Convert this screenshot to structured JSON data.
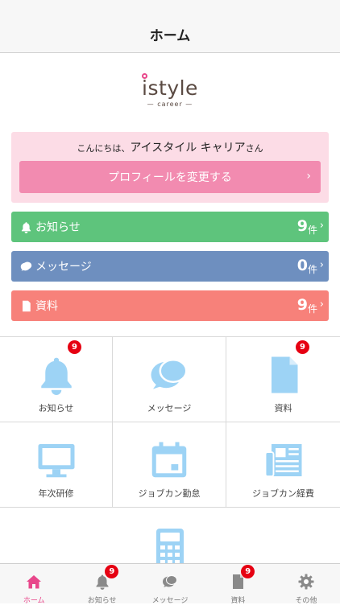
{
  "nav": {
    "title": "ホーム"
  },
  "logo": {
    "text": "istyle",
    "sub": "— career —"
  },
  "greeting": {
    "prefix": "こんにちは、",
    "name": "アイスタイル キャリア",
    "suffix": "さん"
  },
  "profile_button": {
    "label": "プロフィールを変更する",
    "chevron": "›"
  },
  "summary": [
    {
      "label": "お知らせ",
      "count": "9",
      "unit": "件",
      "color": "#5ec47c",
      "icon": "bell-icon"
    },
    {
      "label": "メッセージ",
      "count": "0",
      "unit": "件",
      "color": "#6e8fbf",
      "icon": "chat-icon"
    },
    {
      "label": "資料",
      "count": "9",
      "unit": "件",
      "color": "#f7817a",
      "icon": "document-icon"
    }
  ],
  "grid": [
    {
      "label": "お知らせ",
      "badge": "9",
      "icon": "bell-icon"
    },
    {
      "label": "メッセージ",
      "badge": "",
      "icon": "chat-icon"
    },
    {
      "label": "資料",
      "badge": "9",
      "icon": "document-icon"
    },
    {
      "label": "年次研修",
      "badge": "",
      "icon": "monitor-icon"
    },
    {
      "label": "ジョブカン勤怠",
      "badge": "",
      "icon": "calendar-icon"
    },
    {
      "label": "ジョブカン経費",
      "badge": "",
      "icon": "newspaper-icon"
    }
  ],
  "tabbar": [
    {
      "label": "ホーム",
      "badge": "",
      "icon": "home-icon",
      "active": true
    },
    {
      "label": "お知らせ",
      "badge": "9",
      "icon": "bell-icon",
      "active": false
    },
    {
      "label": "メッセージ",
      "badge": "",
      "icon": "chat-icon",
      "active": false
    },
    {
      "label": "資料",
      "badge": "9",
      "icon": "document-icon",
      "active": false
    },
    {
      "label": "その他",
      "badge": "",
      "icon": "gear-icon",
      "active": false
    }
  ],
  "colors": {
    "accent": "#e8478b",
    "icon_blue": "#9dd3f5",
    "tab_gray": "#8a8a8a",
    "badge_red": "#e60012"
  }
}
